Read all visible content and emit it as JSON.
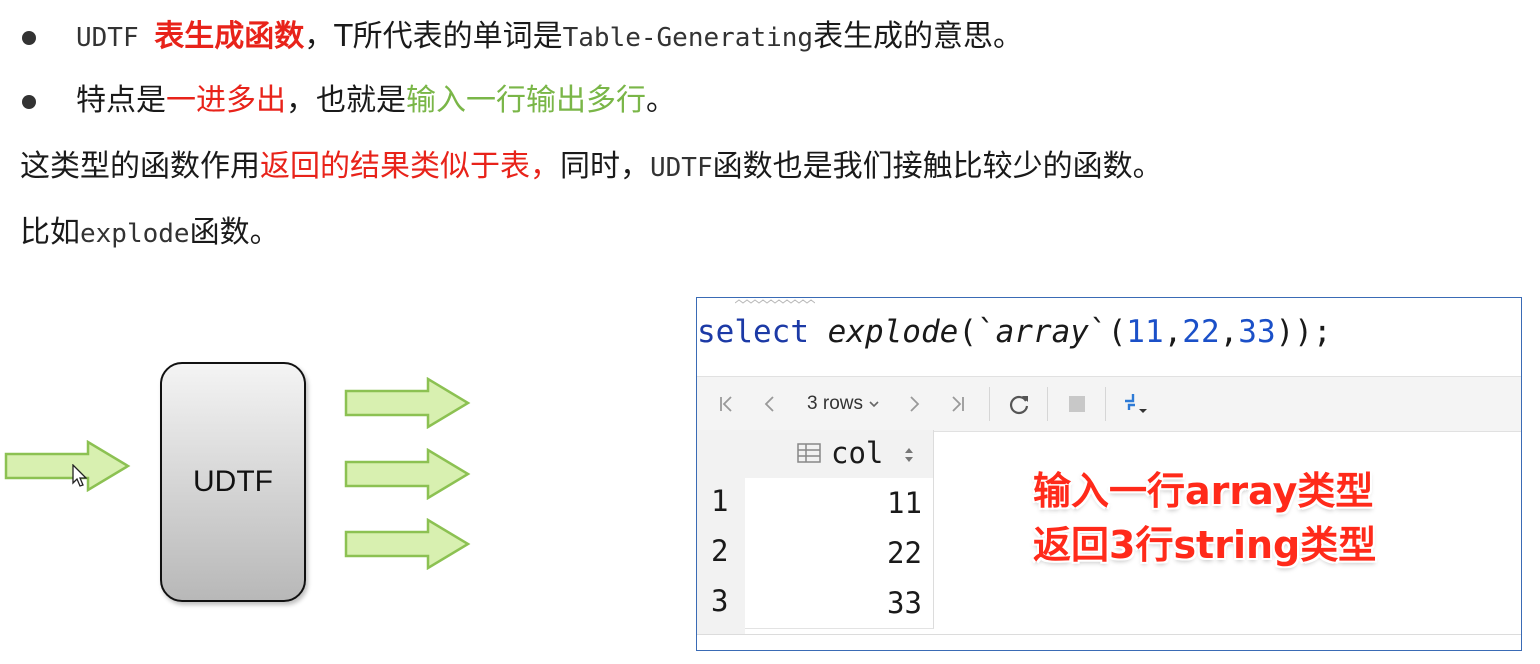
{
  "bullets": [
    {
      "prefix": "UDTF ",
      "highlight": "表生成函数",
      "mid": "，T所代表的单词是",
      "term": "Table-Generating",
      "suffix": "表生成的意思。"
    },
    {
      "prefix": "特点是",
      "highlight_red": "一进多出",
      "mid": "，也就是",
      "highlight_green": "输入一行输出多行",
      "suffix": "。"
    }
  ],
  "paragraph1": {
    "prefix": "这类型的函数作用",
    "highlight": "返回的结果类似于表，",
    "mid": "同时，",
    "term": "UDTF",
    "suffix": "函数也是我们接触比较少的函数。"
  },
  "paragraph2": {
    "prefix": "比如",
    "term": "explode",
    "suffix": "函数。"
  },
  "diagram": {
    "box_label": "UDTF",
    "arrow_color": "#d8f0b0",
    "arrow_border": "#8cc152"
  },
  "db_panel": {
    "sql": {
      "keyword": "select",
      "function": "explode",
      "open": "(`",
      "arg_fn": "array",
      "mid": "`(",
      "n1": "11",
      "c1": ",",
      "n2": "22",
      "c2": ",",
      "n3": "33",
      "close": "));"
    },
    "toolbar": {
      "rows_label": "3 rows",
      "icons": [
        "first-page-icon",
        "prev-page-icon",
        "next-page-icon",
        "last-page-icon",
        "refresh-icon",
        "stop-icon",
        "pin-icon"
      ]
    },
    "table": {
      "column": "col",
      "row_numbers": [
        "1",
        "2",
        "3"
      ],
      "values": [
        "11",
        "22",
        "33"
      ]
    },
    "overlay": {
      "line1": "输入一行array类型",
      "line2": "返回3行string类型"
    }
  }
}
